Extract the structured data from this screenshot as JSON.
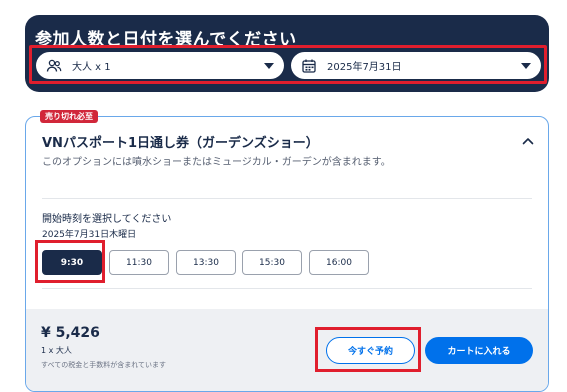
{
  "picker": {
    "title": "参加人数と日付を選んでください",
    "travelers": {
      "label": "大人 x 1",
      "icon": "people-icon"
    },
    "date": {
      "label": "2025年7月31日",
      "icon": "calendar-icon"
    }
  },
  "option": {
    "badge": "売り切れ必至",
    "title": "VNパスポート1日通し券（ガーデンズショー）",
    "description": "このオプションには噴水ショーまたはミュージカル・ガーデンが含まれます。",
    "time_prompt": "開始時刻を選択してください",
    "time_date": "2025年7月31日木曜日",
    "slots": [
      "9:30",
      "11:30",
      "13:30",
      "15:30",
      "16:00"
    ],
    "selected_slot": "9:30"
  },
  "footer": {
    "price": "¥ 5,426",
    "quantity": "1 x 大人",
    "tax_note": "すべての税金と手数料が含まれています",
    "reserve_label": "今すぐ予約",
    "cart_label": "カートに入れる"
  },
  "colors": {
    "navy": "#1a2b49",
    "accent_blue": "#0071eb",
    "badge_red": "#d1273a",
    "highlight_red": "#e01e2d"
  }
}
